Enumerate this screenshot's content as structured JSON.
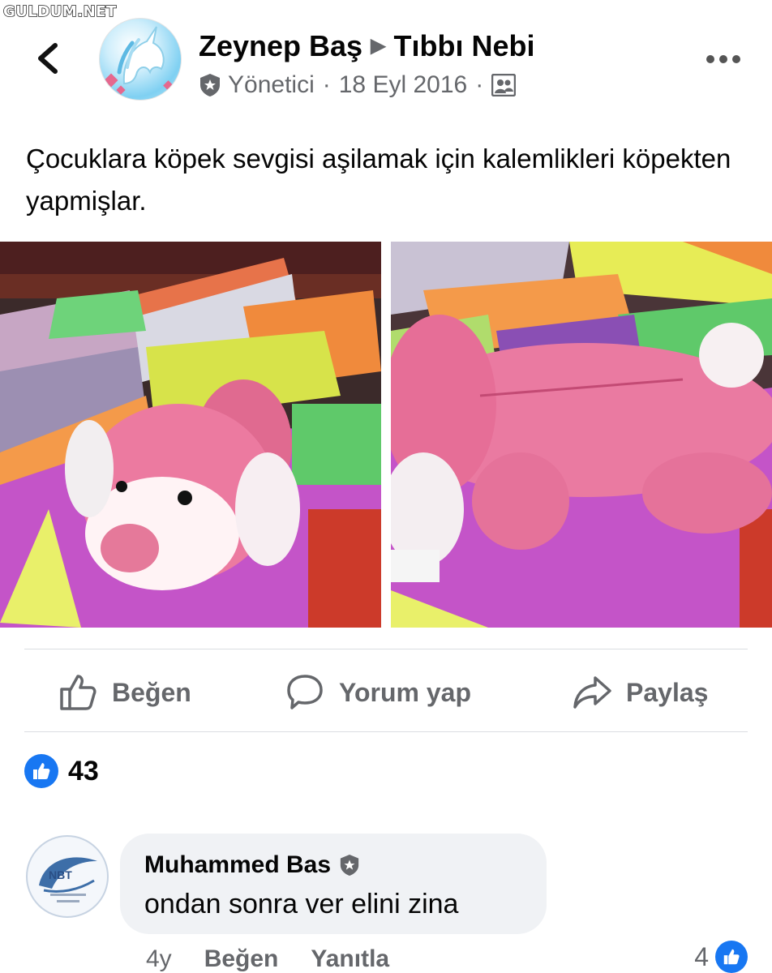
{
  "watermark": "GULDUM.NET",
  "header": {
    "author": "Zeynep Baş",
    "group": "Tıbbı Nebi",
    "role": "Yönetici",
    "date": "18 Eyl 2016",
    "separator": "·"
  },
  "post": {
    "text": "Çocuklara köpek sevgisi aşilamak için kalemlikleri köpekten yapmişlar."
  },
  "actions": {
    "like": "Beğen",
    "comment": "Yorum yap",
    "share": "Paylaş"
  },
  "reactions": {
    "count": "43"
  },
  "comment": {
    "author": "Muhammed Bas",
    "text": "ondan sonra ver elini zina",
    "avatar_text": "NBT",
    "time": "4y",
    "like": "Beğen",
    "reply": "Yanıtla",
    "reaction_count": "4"
  },
  "icons": {
    "back": "chevron-left-icon",
    "more": "more-dots-icon",
    "admin": "shield-star-icon",
    "audience": "group-icon",
    "like": "thumbs-up-icon",
    "comment": "speech-bubble-icon",
    "share": "share-arrow-icon",
    "like_badge": "like-badge-icon"
  },
  "colors": {
    "accent": "#1877f2",
    "secondary_text": "#65676b",
    "bubble": "#f0f2f5"
  }
}
